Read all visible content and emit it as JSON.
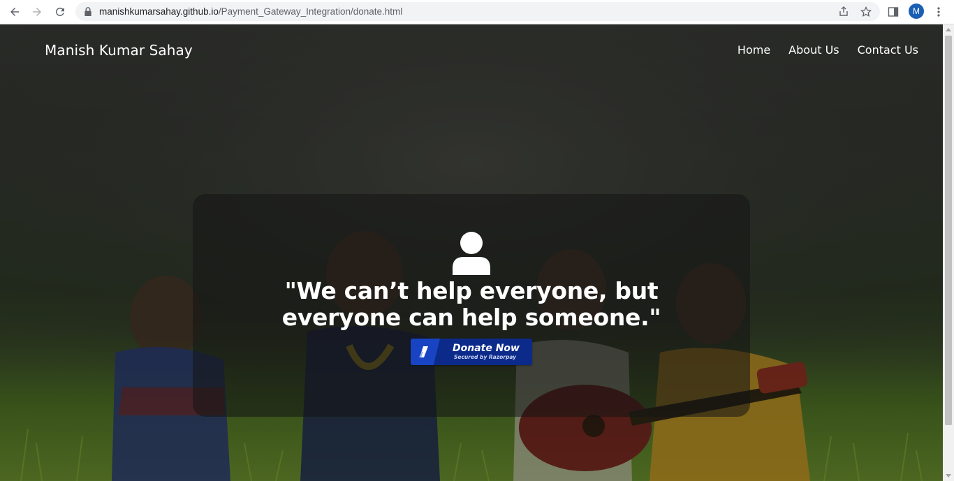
{
  "browser": {
    "url_host": "manishkumarsahay.github.io",
    "url_path": "/Payment_Gateway_Integration/donate.html",
    "profile_initial": "M",
    "icons": [
      "back-icon",
      "forward-icon",
      "reload-icon",
      "lock-icon",
      "share-icon",
      "bookmark-star-icon",
      "side-panel-icon",
      "menu-kebab-icon"
    ]
  },
  "site": {
    "brand": "Manish Kumar Sahay",
    "nav": [
      {
        "label": "Home"
      },
      {
        "label": "About Us"
      },
      {
        "label": "Contact Us"
      }
    ]
  },
  "hero": {
    "quote": "\"We can’t help everyone, but everyone can help someone.\"",
    "icon": "user-icon",
    "donate_button": {
      "label": "Donate Now",
      "sublabel": "Secured by Razorpay",
      "icon": "razorpay-logo-icon"
    }
  },
  "colors": {
    "button_bg": "#0b2a8a",
    "button_logo_bg": "#1844c4",
    "card_bg": "rgba(20,20,20,0.55)",
    "avatar_bg": "#1a5fb4"
  }
}
